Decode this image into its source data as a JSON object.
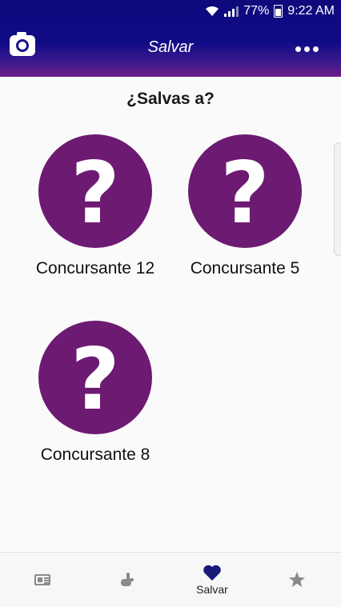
{
  "status_bar": {
    "battery": "77%",
    "time": "9:22 AM"
  },
  "header": {
    "title": "Salvar"
  },
  "question": "¿Salvas a?",
  "contestants": [
    {
      "name": "Concursante 12",
      "symbol": "?"
    },
    {
      "name": "Concursante 5",
      "symbol": "?"
    },
    {
      "name": "Concursante 8",
      "symbol": "?"
    }
  ],
  "bottom_nav": {
    "items": [
      {
        "icon": "news-icon",
        "label": ""
      },
      {
        "icon": "hand-icon",
        "label": ""
      },
      {
        "icon": "heart-icon",
        "label": "Salvar",
        "active": true
      },
      {
        "icon": "star-icon",
        "label": ""
      }
    ]
  },
  "colors": {
    "header": "#0f0b86",
    "accent": "#6d1a72",
    "active_nav": "#1a1a7a"
  }
}
